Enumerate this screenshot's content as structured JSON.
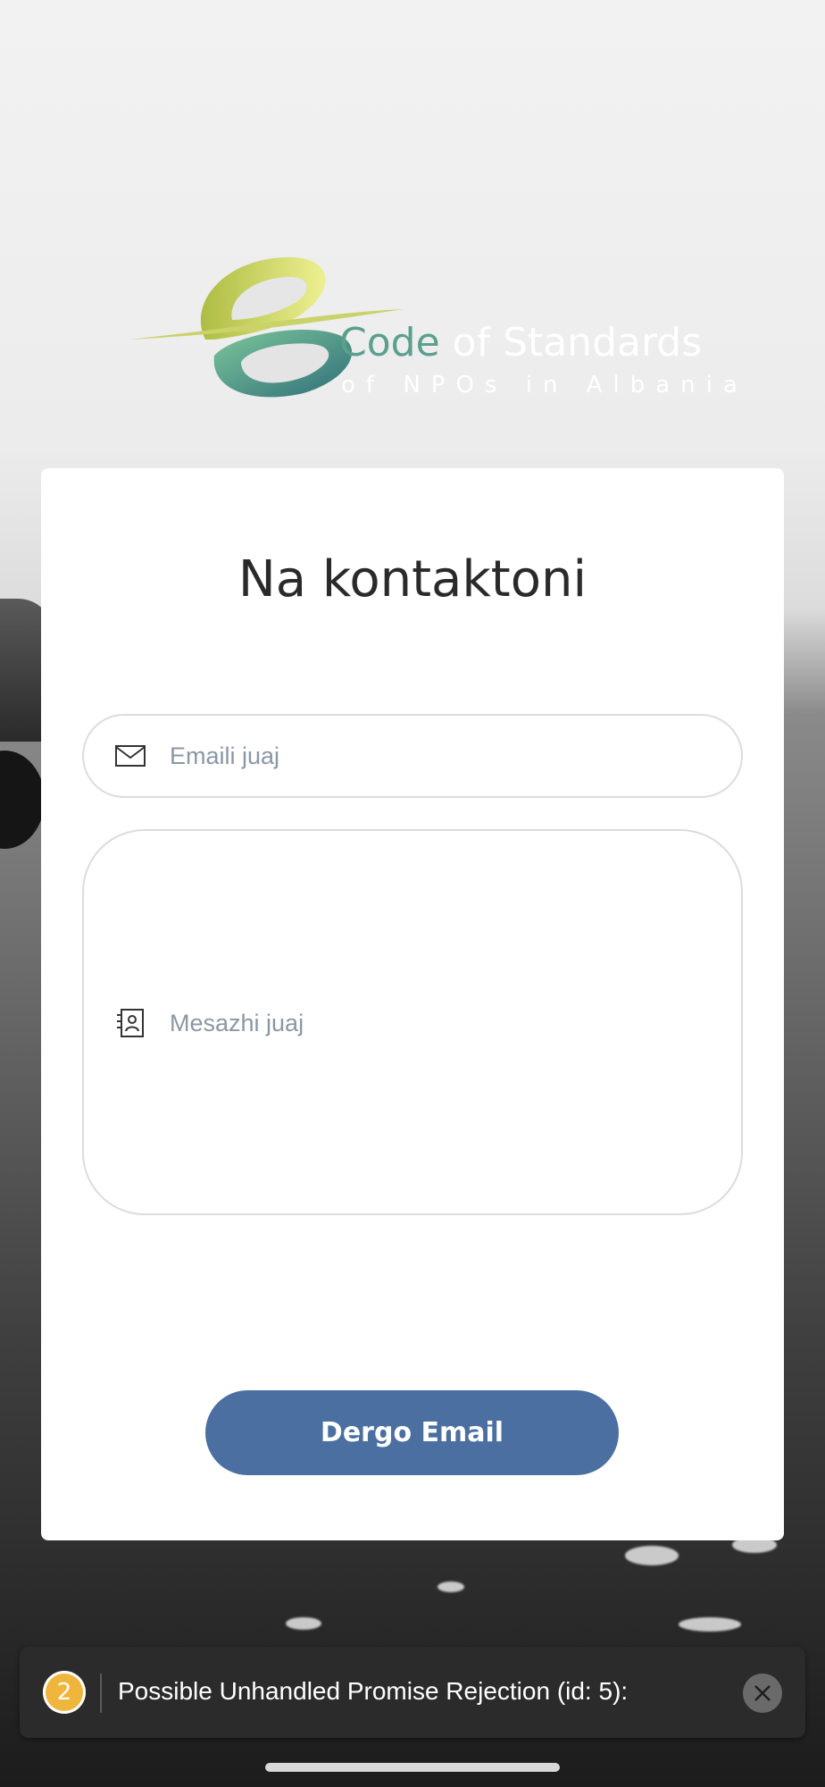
{
  "logo": {
    "brand_word": "Code",
    "tagline_rest": " of Standards",
    "subline": "of NPOs in Albania"
  },
  "contact": {
    "title": "Na kontaktoni",
    "email_placeholder": "Emaili juaj",
    "message_placeholder": "Mesazhi juaj",
    "send_label": "Dergo Email"
  },
  "toast": {
    "count": "2",
    "message": "Possible Unhandled Promise Rejection (id: 5):"
  },
  "icons": {
    "email": "envelope-icon",
    "message": "contact-card-icon",
    "close": "close-icon"
  },
  "colors": {
    "button": "#4a6fa0",
    "badge": "#f0b53c",
    "logo_green": "#5aa08c",
    "logo_yellow": "#e3e27a"
  }
}
